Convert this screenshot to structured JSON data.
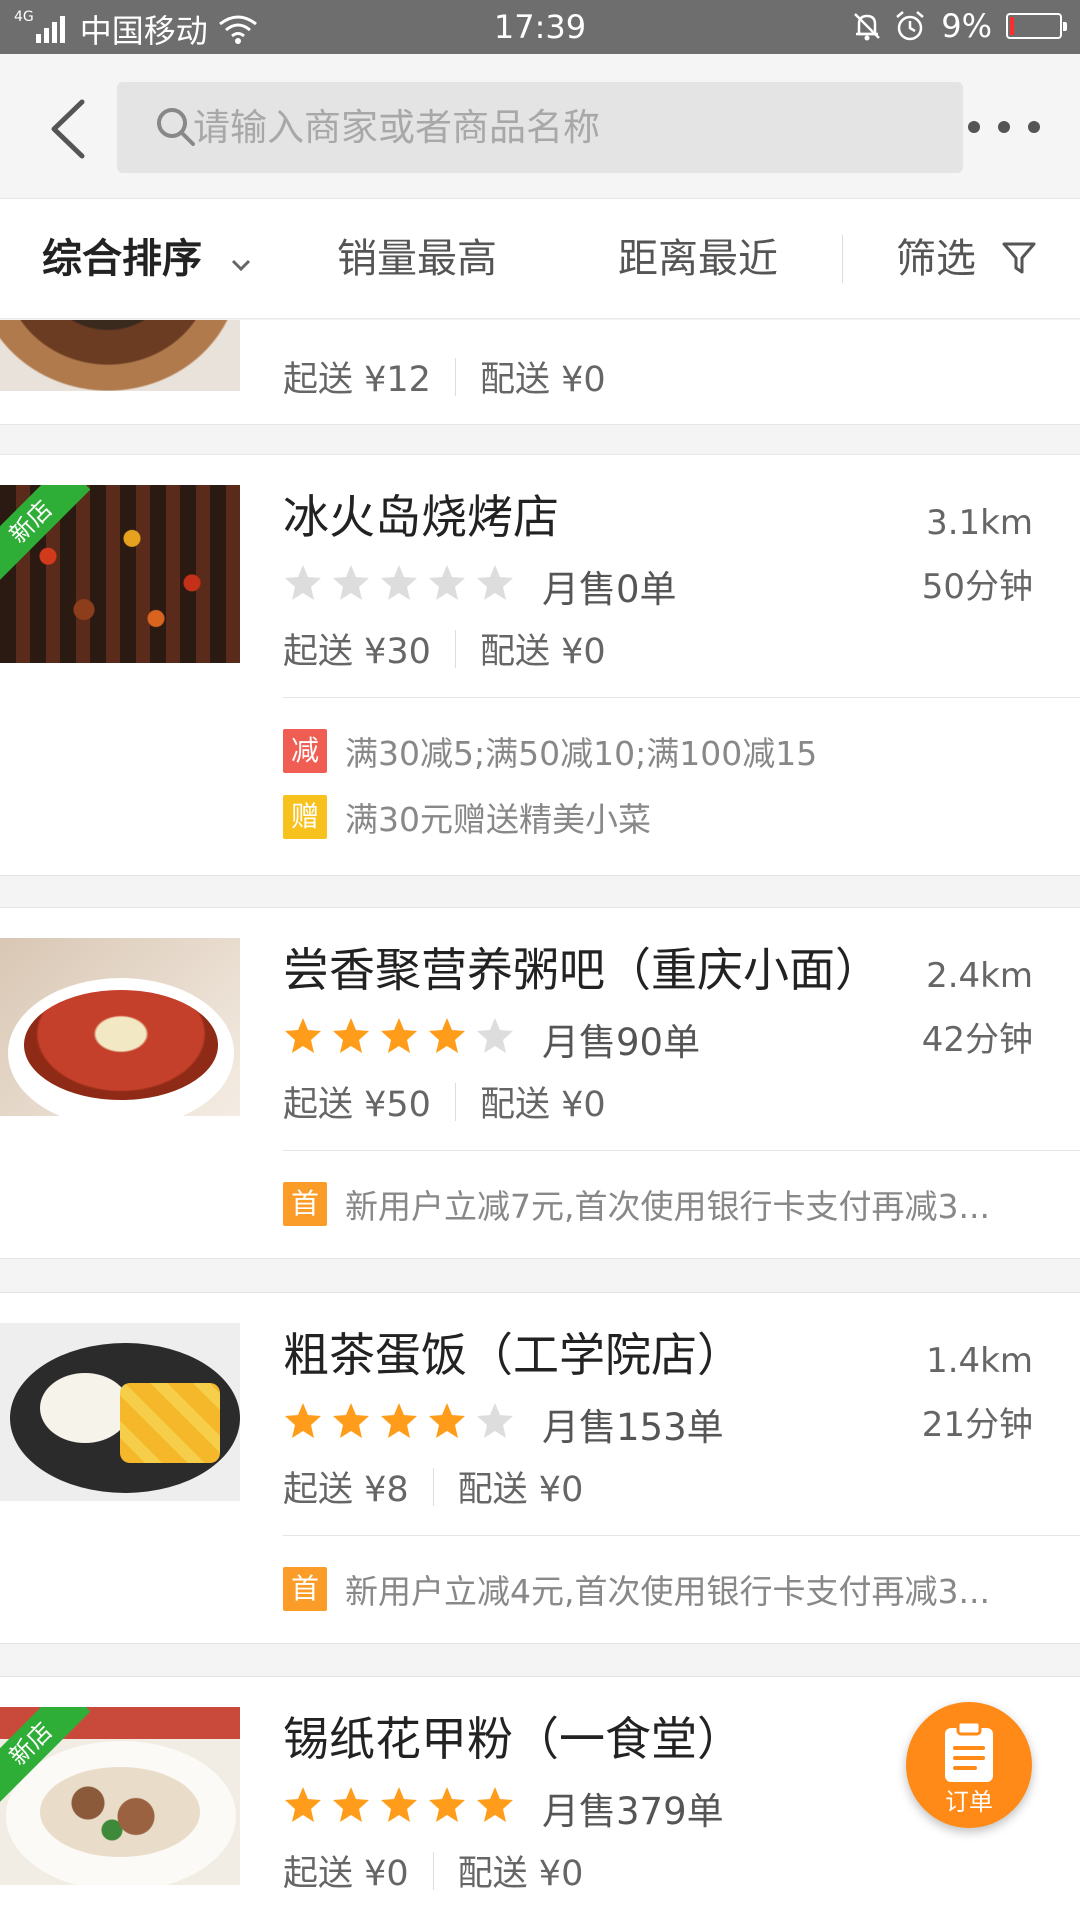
{
  "status_bar": {
    "network": "4G",
    "carrier": "中国移动",
    "time": "17:39",
    "battery": "9%",
    "battery_level": 0.09
  },
  "header": {
    "search_placeholder": "请输入商家或者商品名称"
  },
  "tabs": [
    {
      "label": "综合排序"
    },
    {
      "label": "销量最高"
    },
    {
      "label": "距离最近"
    },
    {
      "label": "筛选"
    }
  ],
  "stores": [
    {
      "min_order": "起送 ¥12",
      "delivery_fee": "配送 ¥0"
    },
    {
      "name": "冰火岛烧烤店",
      "distance": "3.1km",
      "rating": 0,
      "sales": "月售0单",
      "time": "50分钟",
      "min_order": "起送 ¥30",
      "delivery_fee": "配送 ¥0",
      "new_badge": "新店",
      "promos": [
        {
          "badge": "减",
          "color": "#f05d53",
          "text": "满30减5;满50减10;满100减15"
        },
        {
          "badge": "赠",
          "color": "#f7c21e",
          "text": "满30元赠送精美小菜"
        }
      ]
    },
    {
      "name": "尝香聚营养粥吧（重庆小面）",
      "distance": "2.4km",
      "rating": 4,
      "sales": "月售90单",
      "time": "42分钟",
      "min_order": "起送 ¥50",
      "delivery_fee": "配送 ¥0",
      "promos": [
        {
          "badge": "首",
          "color": "#fb9b28",
          "text": "新用户立减7元,首次使用银行卡支付再减3..."
        }
      ]
    },
    {
      "name": "粗茶蛋饭（工学院店）",
      "distance": "1.4km",
      "rating": 4,
      "sales": "月售153单",
      "time": "21分钟",
      "min_order": "起送 ¥8",
      "delivery_fee": "配送 ¥0",
      "promos": [
        {
          "badge": "首",
          "color": "#fb9b28",
          "text": "新用户立减4元,首次使用银行卡支付再减3..."
        }
      ]
    },
    {
      "name": "锡纸花甲粉（一食堂）",
      "rating": 5,
      "sales": "月售379单",
      "min_order": "起送 ¥0",
      "delivery_fee": "配送 ¥0",
      "new_badge": "新店"
    }
  ],
  "fab": {
    "label": "订单"
  },
  "colors": {
    "star_on": "#ff9d1a",
    "star_off": "#dddddd",
    "fab": "#ff8a17",
    "new_ribbon": "#2fae37"
  }
}
